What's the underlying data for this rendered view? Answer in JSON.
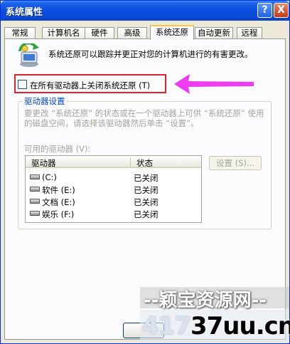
{
  "window": {
    "title": "系统属性"
  },
  "title_buttons": {
    "help": "?",
    "close": "X"
  },
  "tabs": [
    {
      "label": "常规"
    },
    {
      "label": "计算机名"
    },
    {
      "label": "硬件"
    },
    {
      "label": "高级"
    },
    {
      "label": "系统还原"
    },
    {
      "label": "自动更新"
    },
    {
      "label": "远程"
    }
  ],
  "active_tab": "系统还原",
  "restore": {
    "description": "系统还原可以跟踪并更正对您的计算机进行的有害更改。",
    "disable_all_checkbox": {
      "label": "在所有驱动器上关闭系统还原 (T)",
      "checked": false
    }
  },
  "drive_settings": {
    "title": "驱动器设置",
    "description": "要更改 “系统还原” 的状态或在一个驱动器上可供 “系统还原” 使用的磁盘空间，请选择该驱动器然后单击 “设置”。",
    "available_label": "可用的驱动器 (V):",
    "columns": [
      "驱动器",
      "状态"
    ],
    "drives": [
      {
        "name": "(C:)",
        "status": "已关闭"
      },
      {
        "name": "软件  (E:)",
        "status": "已关闭"
      },
      {
        "name": "文档  (E:)",
        "status": "已关闭"
      },
      {
        "name": "娱乐  (F:)",
        "status": "已关闭"
      }
    ],
    "settings_button": "设置 (S)..."
  },
  "watermark": {
    "site_name": "--颖宝资源网--",
    "faint_text": "417",
    "domain": "37uu.cn"
  },
  "colors": {
    "highlight_box": "#e1222c",
    "arrow": "#ee3df0",
    "group_title": "#0046d5",
    "disabled_text": "#a3a39a"
  }
}
